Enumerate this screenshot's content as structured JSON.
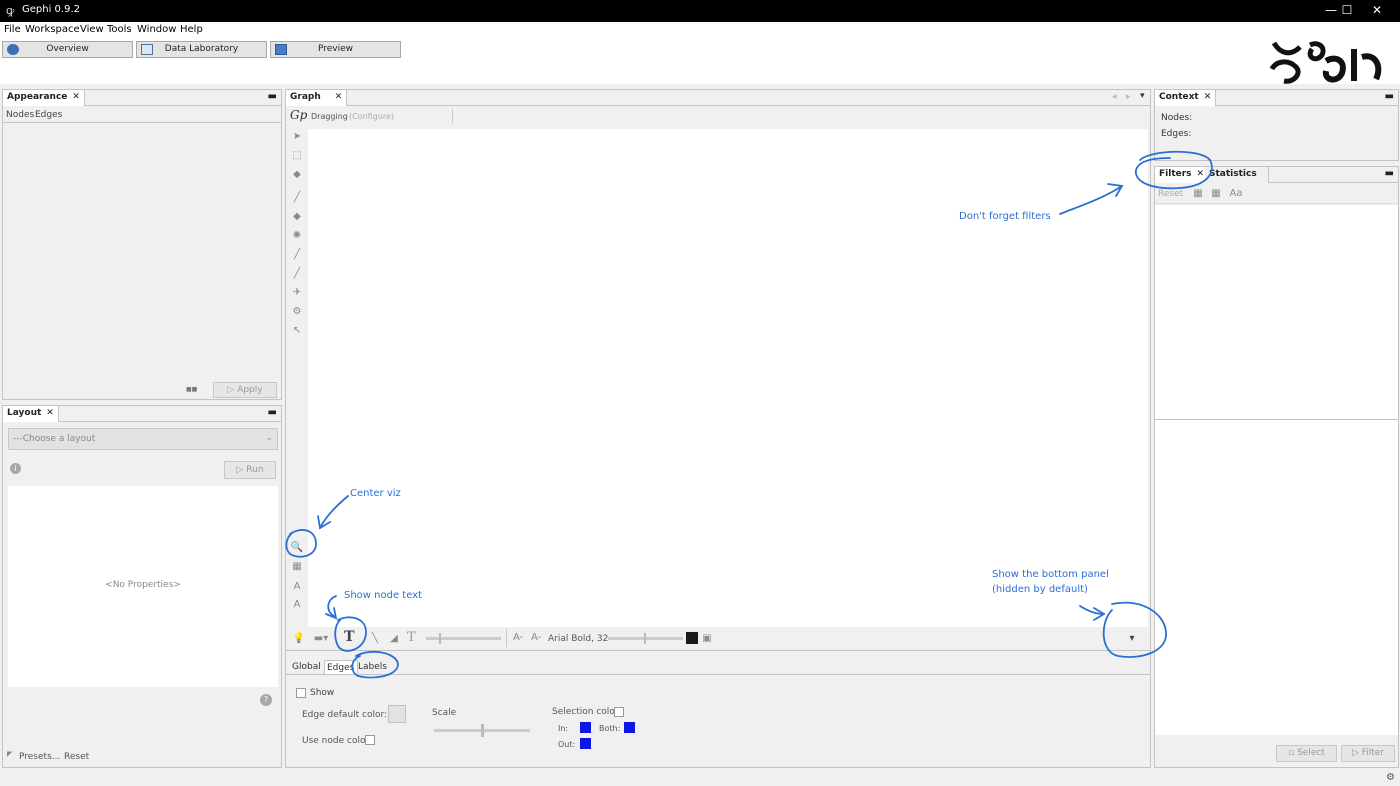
{
  "window": {
    "title": "Gephi 0.9.2",
    "minimize": "—",
    "maximize": "☐",
    "close": "✕"
  },
  "menu": [
    "File",
    "Workspace",
    "View",
    "Tools",
    "Window",
    "Help"
  ],
  "modes": {
    "overview": "Overview",
    "data_lab": "Data Laboratory",
    "preview": "Preview"
  },
  "appearance": {
    "tab": "Appearance",
    "subtabs": [
      "Nodes",
      "Edges"
    ],
    "apply": "Apply",
    "mini": "■■"
  },
  "layout": {
    "tab": "Layout",
    "select_placeholder": "---Choose a layout",
    "run": "Run",
    "no_props": "<No Properties>",
    "presets": "Presets...",
    "reset": "Reset"
  },
  "graph": {
    "tab": "Graph",
    "mode": "Dragging",
    "configure": "(Configure)",
    "font_label": "Arial Bold, 32",
    "colors": {
      "dark_swatch": "#1a1a1a",
      "blue": "#0a17e6"
    }
  },
  "bottom_panel": {
    "tabs": [
      "Global",
      "Edges",
      "Labels"
    ],
    "show": "Show",
    "edge_default_color": "Edge default color:",
    "scale": "Scale",
    "selection_color": "Selection color",
    "use_node_color": "Use node color",
    "in": "In:",
    "both": "Both:",
    "out": "Out:"
  },
  "context": {
    "tab": "Context",
    "nodes": "Nodes:",
    "edges": "Edges:"
  },
  "filters": {
    "tabs": [
      "Filters",
      "Statistics"
    ],
    "reset": "Reset",
    "select": "Select",
    "filter": "Filter"
  },
  "annotations": {
    "filters": "Don't forget filters",
    "center": "Center viz",
    "node_text": "Show node text",
    "bottom1": "Show the bottom panel",
    "bottom2": "(hidden by default)",
    "color": "#2a6fd6"
  }
}
